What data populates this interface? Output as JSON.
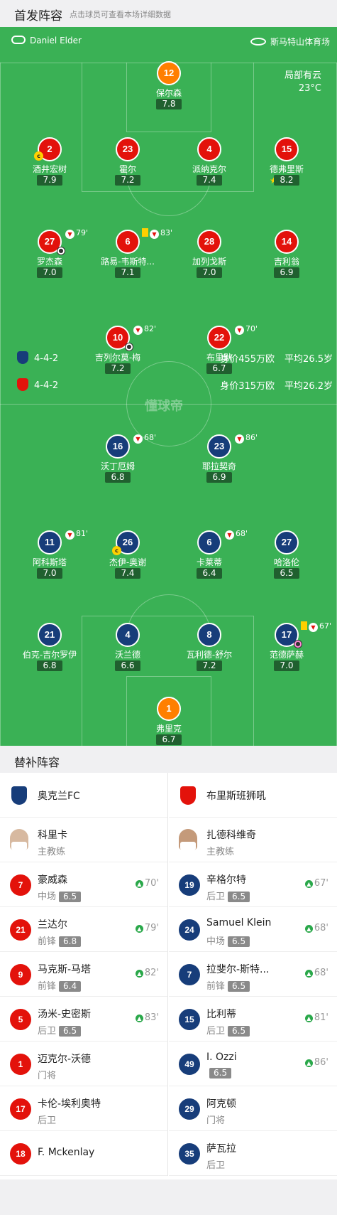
{
  "header": {
    "title": "首发阵容",
    "subtitle": "点击球员可查看本场详细数据"
  },
  "match": {
    "referee": "Daniel Elder",
    "venue": "斯马特山体育场",
    "weather": "局部有云",
    "temperature": "23°C",
    "watermark": "懂球帝"
  },
  "home_team": {
    "name": "奥克兰FC",
    "formation": "4-4-2",
    "value": "身价455万欧",
    "avg_age": "平均26.5岁",
    "color": "#173d7a"
  },
  "away_team": {
    "name": "布里斯班狮吼",
    "formation": "4-4-2",
    "value": "身价315万欧",
    "avg_age": "平均26.2岁",
    "color": "#e3120b"
  },
  "top_players": [
    {
      "num": "12",
      "name": "保尔森",
      "rating": "7.8"
    },
    {
      "num": "2",
      "name": "酒井宏树",
      "rating": "7.9"
    },
    {
      "num": "23",
      "name": "霍尔",
      "rating": "7.2"
    },
    {
      "num": "4",
      "name": "派纳克尔",
      "rating": "7.4"
    },
    {
      "num": "15",
      "name": "德弗里斯",
      "rating": "8.2"
    },
    {
      "num": "27",
      "name": "罗杰森",
      "rating": "7.0",
      "sub": "79'"
    },
    {
      "num": "6",
      "name": "路易-韦斯特...",
      "rating": "7.1",
      "sub": "83'"
    },
    {
      "num": "28",
      "name": "加列戈斯",
      "rating": "7.0"
    },
    {
      "num": "14",
      "name": "吉利翁",
      "rating": "6.9"
    },
    {
      "num": "10",
      "name": "吉列尔莫-梅",
      "rating": "7.2",
      "sub": "82'"
    },
    {
      "num": "22",
      "name": "布里默",
      "rating": "6.7",
      "sub": "70'"
    }
  ],
  "bottom_players": [
    {
      "num": "16",
      "name": "沃丁厄姆",
      "rating": "6.8",
      "sub": "68'"
    },
    {
      "num": "23",
      "name": "耶拉契奇",
      "rating": "6.9",
      "sub": "86'"
    },
    {
      "num": "11",
      "name": "阿科斯塔",
      "rating": "7.0",
      "sub": "81'"
    },
    {
      "num": "26",
      "name": "杰伊-奥谢",
      "rating": "7.4"
    },
    {
      "num": "6",
      "name": "卡莱蒂",
      "rating": "6.4",
      "sub": "68'"
    },
    {
      "num": "27",
      "name": "哈洛伦",
      "rating": "6.5"
    },
    {
      "num": "21",
      "name": "伯克-吉尔罗伊",
      "rating": "6.8"
    },
    {
      "num": "4",
      "name": "沃兰德",
      "rating": "6.6"
    },
    {
      "num": "8",
      "name": "瓦利德-舒尔",
      "rating": "7.2"
    },
    {
      "num": "17",
      "name": "范德萨赫",
      "rating": "7.0",
      "sub": "67'"
    },
    {
      "num": "1",
      "name": "弗里克",
      "rating": "6.7"
    }
  ],
  "subs": {
    "title": "替补阵容",
    "left_coach": {
      "name": "科里卡",
      "role": "主教练"
    },
    "right_coach": {
      "name": "扎德科维奇",
      "role": "主教练"
    },
    "left": [
      {
        "num": "7",
        "name": "豪威森",
        "pos": "中场",
        "rating": "6.5",
        "time": "70'"
      },
      {
        "num": "21",
        "name": "兰达尔",
        "pos": "前锋",
        "rating": "6.8",
        "time": "79'"
      },
      {
        "num": "9",
        "name": "马克斯-马塔",
        "pos": "前锋",
        "rating": "6.4",
        "time": "82'"
      },
      {
        "num": "5",
        "name": "汤米-史密斯",
        "pos": "后卫",
        "rating": "6.5",
        "time": "83'"
      },
      {
        "num": "1",
        "name": "迈克尔-沃德",
        "pos": "门将",
        "rating": "",
        "time": ""
      },
      {
        "num": "17",
        "name": "卡伦-埃利奥特",
        "pos": "后卫",
        "rating": "",
        "time": ""
      },
      {
        "num": "18",
        "name": "F. Mckenlay",
        "pos": "",
        "rating": "",
        "time": ""
      }
    ],
    "right": [
      {
        "num": "19",
        "name": "辛格尔特",
        "pos": "后卫",
        "rating": "6.5",
        "time": "67'"
      },
      {
        "num": "24",
        "name": "Samuel Klein",
        "pos": "中场",
        "rating": "6.5",
        "time": "68'"
      },
      {
        "num": "7",
        "name": "拉斐尔-斯特...",
        "pos": "前锋",
        "rating": "6.5",
        "time": "68'"
      },
      {
        "num": "15",
        "name": "比利蒂",
        "pos": "后卫",
        "rating": "6.5",
        "time": "81'"
      },
      {
        "num": "49",
        "name": "I. Ozzi",
        "pos": "",
        "rating": "6.5",
        "time": "86'"
      },
      {
        "num": "29",
        "name": "阿克顿",
        "pos": "门将",
        "rating": "",
        "time": ""
      },
      {
        "num": "35",
        "name": "萨瓦拉",
        "pos": "后卫",
        "rating": "",
        "time": ""
      }
    ]
  }
}
